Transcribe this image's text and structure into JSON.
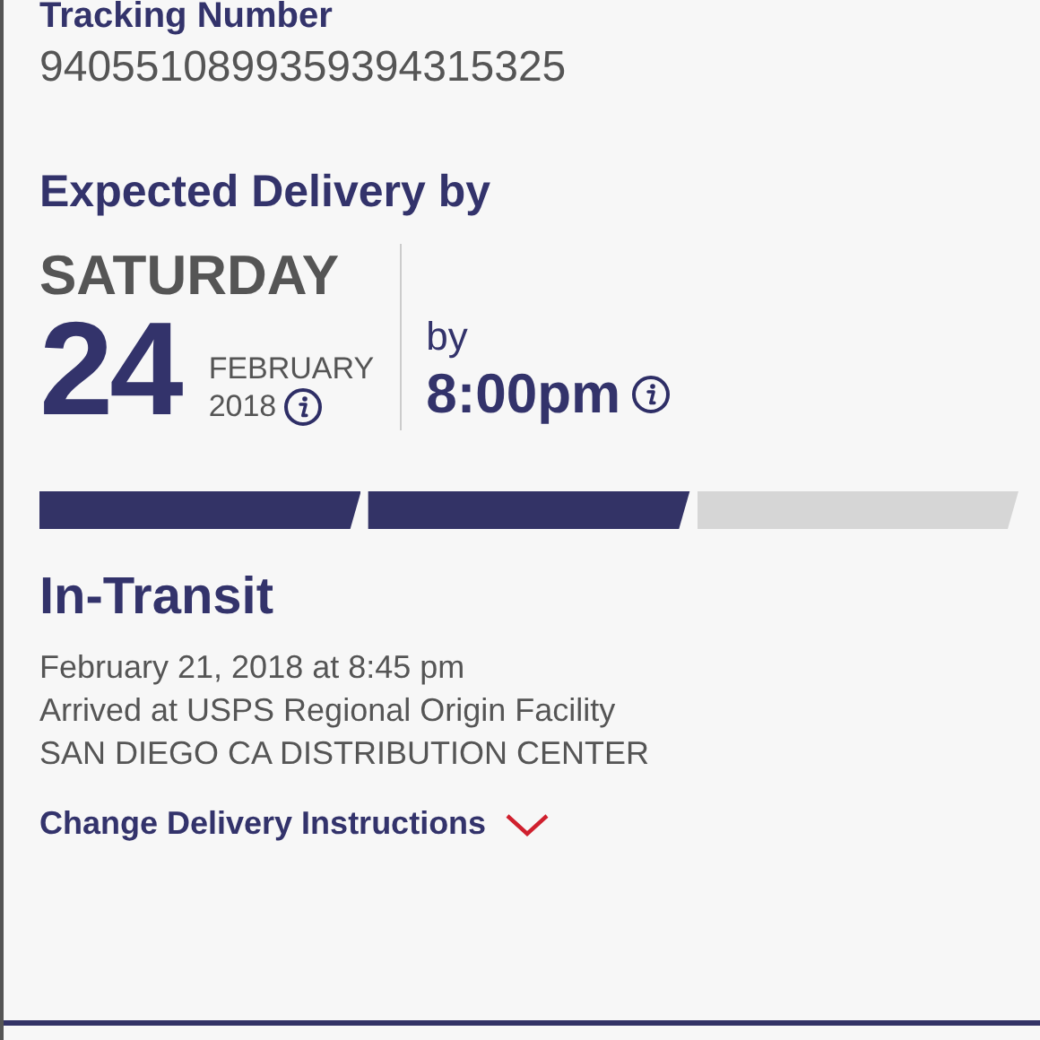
{
  "tracking": {
    "label": "Tracking Number",
    "number": "9405510899359394315325"
  },
  "expected": {
    "heading": "Expected Delivery by",
    "weekday": "SATURDAY",
    "day": "24",
    "month": "FEBRUARY",
    "year": "2018",
    "by_label": "by",
    "time": "8:00pm"
  },
  "progress": [
    {
      "filled": true
    },
    {
      "filled": true
    },
    {
      "filled": false
    }
  ],
  "status": {
    "title": "In-Transit",
    "lines": [
      "February 21, 2018 at 8:45 pm",
      "Arrived at USPS Regional Origin Facility",
      "SAN DIEGO CA DISTRIBUTION CENTER"
    ]
  },
  "link": {
    "label": "Change Delivery Instructions",
    "expanded": false
  }
}
